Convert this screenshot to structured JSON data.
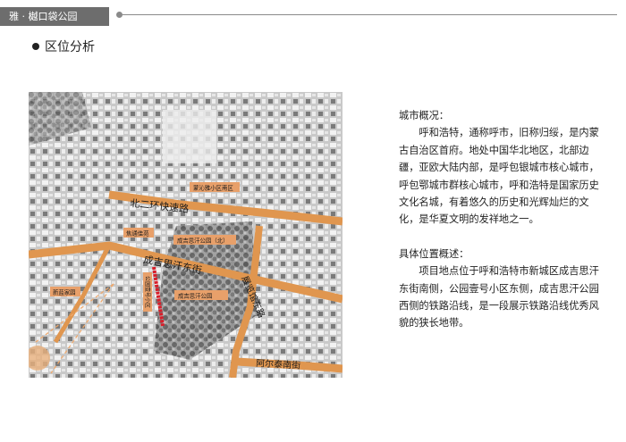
{
  "header": {
    "title": "雅 · 樾口袋公园"
  },
  "section": {
    "title": "区位分析"
  },
  "map": {
    "places": [
      "蒙沁雅小区南区",
      "焦通佳苑",
      "成吉思汗公园（北）",
      "公园壹号小区",
      "成吉思汗公园",
      "新蓝家园"
    ],
    "roads": [
      "北二环快速路",
      "成吉思汗东街",
      "展览馆东路",
      "阿尔泰南街"
    ],
    "colors": {
      "road": "#e0964f",
      "site": "#d91e2a",
      "label_bg": "#e8a06a"
    }
  },
  "overview": {
    "heading": "城市概况：",
    "body": "呼和浩特，通称呼市，旧称归绥，是内蒙古自治区首府。地处中国华北地区，北部边疆，亚欧大陆内部，是呼包银城市核心城市，呼包鄂城市群核心城市，呼和浩特是国家历史文化名城，有着悠久的历史和光辉灿烂的文化，是华夏文明的发祥地之一。"
  },
  "location": {
    "heading": "具体位置概述：",
    "body": "项目地点位于呼和浩特市新城区成吉思汗东街南侧，公园壹号小区东侧，成吉思汗公园西侧的铁路沿线，是一段展示铁路沿线优秀风貌的狭长地带。"
  }
}
